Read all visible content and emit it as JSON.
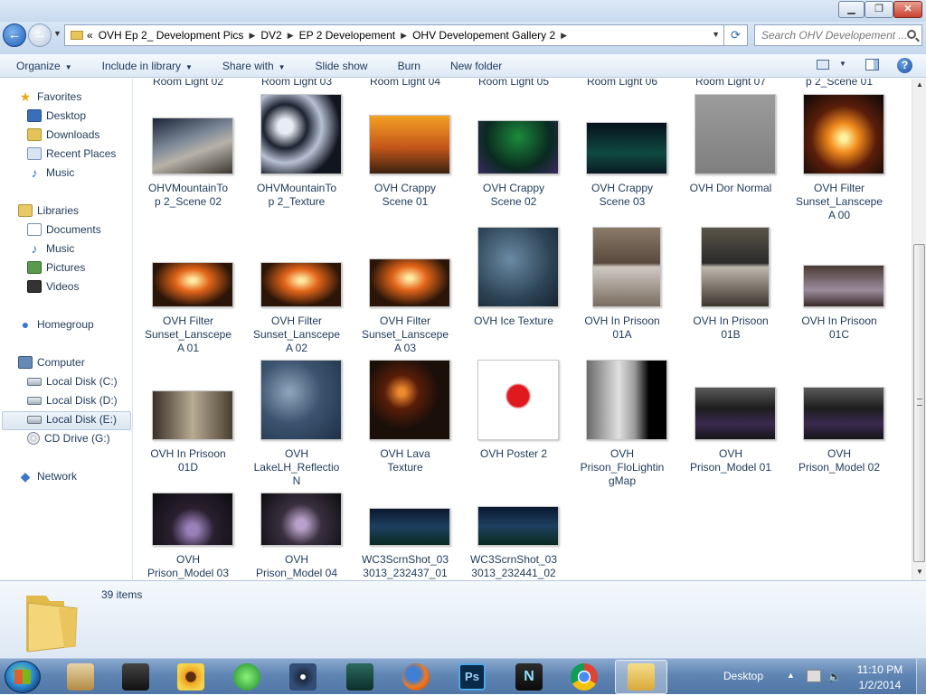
{
  "address": {
    "crumbs": [
      "«",
      "OVH Ep 2_ Development Pics",
      "DV2",
      "EP 2 Developement",
      "OHV Developement Gallery 2"
    ],
    "search_placeholder": "Search OHV Developement ..."
  },
  "toolbar": {
    "organize": "Organize",
    "include_in_library": "Include in library",
    "share_with": "Share with",
    "slide_show": "Slide show",
    "burn": "Burn",
    "new_folder": "New folder"
  },
  "nav": {
    "favorites": "Favorites",
    "desktop": "Desktop",
    "downloads": "Downloads",
    "recent_places": "Recent Places",
    "music_fav": "Music",
    "libraries": "Libraries",
    "documents": "Documents",
    "music": "Music",
    "pictures": "Pictures",
    "videos": "Videos",
    "homegroup": "Homegroup",
    "computer": "Computer",
    "disk_c": "Local Disk (C:)",
    "disk_d": "Local Disk (D:)",
    "disk_e": "Local Disk (E:)",
    "cd_g": "CD Drive (G:)",
    "network": "Network"
  },
  "partial_row": [
    "Room Light 02",
    "Room Light 03",
    "Room Light 04",
    "Room Light 05",
    "Room Light 06",
    "Room Light 07",
    "p 2_Scene 01"
  ],
  "items": [
    [
      "OHVMountainTo",
      "p 2_Scene 02"
    ],
    [
      "OHVMountainTo",
      "p 2_Texture"
    ],
    [
      "OVH Crappy",
      "Scene 01"
    ],
    [
      "OVH Crappy",
      "Scene 02"
    ],
    [
      "OVH Crappy",
      "Scene 03"
    ],
    [
      "OVH Dor Normal"
    ],
    [
      "OVH Filter",
      "Sunset_Lanscepe",
      "A 00"
    ],
    [
      "OVH Filter",
      "Sunset_Lanscepe",
      "A 01"
    ],
    [
      "OVH Filter",
      "Sunset_Lanscepe",
      "A 02"
    ],
    [
      "OVH Filter",
      "Sunset_Lanscepe",
      "A 03"
    ],
    [
      "OVH Ice Texture"
    ],
    [
      "OVH In Prisoon",
      "01A"
    ],
    [
      "OVH In Prisoon",
      "01B"
    ],
    [
      "OVH In Prisoon",
      "01C"
    ],
    [
      "OVH In Prisoon",
      "01D"
    ],
    [
      "OVH",
      "LakeLH_Reflectio",
      "N"
    ],
    [
      "OVH Lava",
      "Texture"
    ],
    [
      "OVH Poster 2"
    ],
    [
      "OVH",
      "Prison_FloLightin",
      "gMap"
    ],
    [
      "OVH",
      "Prison_Model 01"
    ],
    [
      "OVH",
      "Prison_Model 02"
    ],
    [
      "OVH",
      "Prison_Model 03"
    ],
    [
      "OVH",
      "Prison_Model 04"
    ],
    [
      "WC3ScrnShot_03",
      "3013_232437_01"
    ],
    [
      "WC3ScrnShot_03",
      "3013_232441_02"
    ]
  ],
  "status": {
    "item_count": "39 items"
  },
  "taskbar": {
    "desktop_label": "Desktop",
    "time": "11:10 PM",
    "date": "1/2/2014"
  }
}
